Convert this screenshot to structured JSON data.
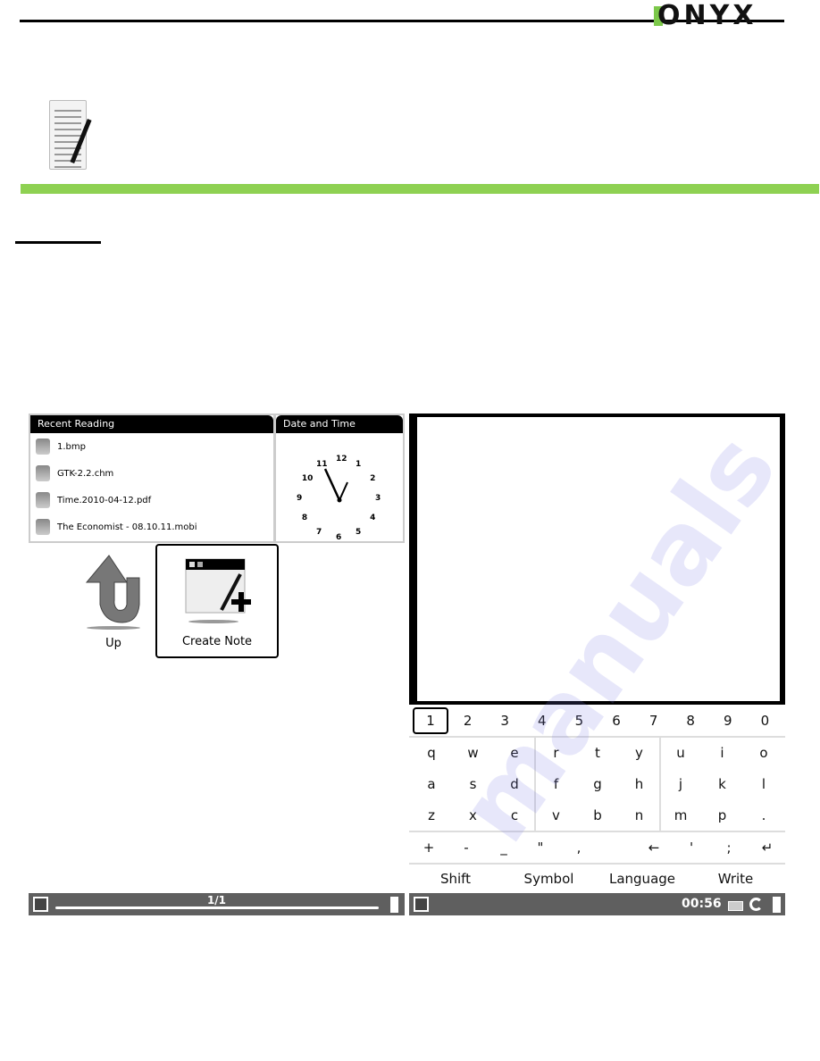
{
  "header": {
    "logo_text": "ONYX",
    "brand_color": "#8ed152"
  },
  "watermark": "manuals",
  "left_screen": {
    "recent_reading": {
      "title": "Recent Reading",
      "items": [
        "1.bmp",
        "GTK-2.2.chm",
        "Time.2010-04-12.pdf",
        "The Economist - 08.10.11.mobi"
      ]
    },
    "date_time": {
      "title": "Date and Time",
      "clock_numbers": [
        "12",
        "1",
        "2",
        "3",
        "4",
        "5",
        "6",
        "7",
        "8",
        "9",
        "10",
        "11"
      ]
    },
    "tiles": [
      {
        "label": "Up",
        "icon": "up-arrow-icon"
      },
      {
        "label": "Create Note",
        "icon": "create-note-icon",
        "selected": true
      }
    ],
    "status": {
      "page": "1/1"
    }
  },
  "right_screen": {
    "keyboard": {
      "numbers": [
        "1",
        "2",
        "3",
        "4",
        "5",
        "6",
        "7",
        "8",
        "9",
        "0"
      ],
      "letters": [
        [
          "q",
          "w",
          "e",
          "r",
          "t",
          "y",
          "u",
          "i",
          "o"
        ],
        [
          "a",
          "s",
          "d",
          "f",
          "g",
          "h",
          "j",
          "k",
          "l"
        ],
        [
          "z",
          "x",
          "c",
          "v",
          "b",
          "n",
          "m",
          "p",
          "."
        ]
      ],
      "symbols": [
        "+",
        "-",
        "_",
        "\"",
        ",",
        "←",
        "'",
        ";",
        "↵"
      ],
      "functions": [
        "Shift",
        "Symbol",
        "Language",
        "Write"
      ],
      "selected_key": "1"
    },
    "status": {
      "time": "00:56"
    }
  }
}
